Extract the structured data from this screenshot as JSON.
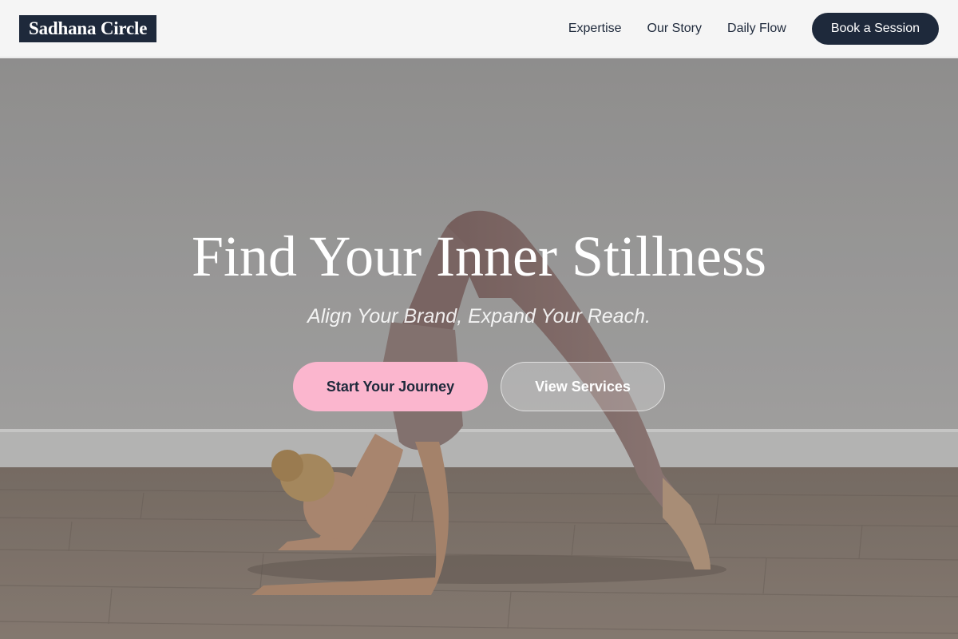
{
  "header": {
    "logo": "Sadhana Circle",
    "nav": [
      "Expertise",
      "Our Story",
      "Daily Flow"
    ],
    "cta": "Book a Session"
  },
  "hero": {
    "image": "yoga-pose-photo",
    "title": "Find Your Inner Stillness",
    "subtitle": "Align Your Brand, Expand Your Reach.",
    "primary_button": "Start Your Journey",
    "secondary_button": "View Services"
  },
  "colors": {
    "navy": "#1e293b",
    "pink": "#fbb6ce",
    "header_bg": "#f5f5f5"
  }
}
